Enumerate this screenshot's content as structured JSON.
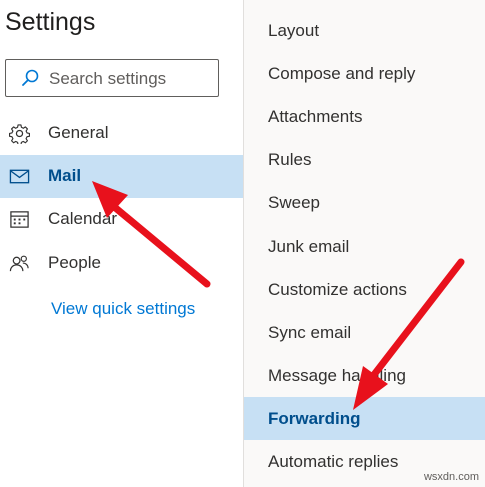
{
  "settings": {
    "title": "Settings",
    "search_placeholder": "Search settings"
  },
  "nav": {
    "items": [
      {
        "label": "General",
        "icon": "gear-icon"
      },
      {
        "label": "Mail",
        "icon": "mail-icon",
        "selected": true
      },
      {
        "label": "Calendar",
        "icon": "calendar-icon"
      },
      {
        "label": "People",
        "icon": "people-icon"
      }
    ],
    "quick_settings_link": "View quick settings"
  },
  "mail_settings": {
    "items": [
      {
        "label": "Layout"
      },
      {
        "label": "Compose and reply"
      },
      {
        "label": "Attachments"
      },
      {
        "label": "Rules"
      },
      {
        "label": "Sweep"
      },
      {
        "label": "Junk email"
      },
      {
        "label": "Customize actions"
      },
      {
        "label": "Sync email"
      },
      {
        "label": "Message handling"
      },
      {
        "label": "Forwarding",
        "selected": true
      },
      {
        "label": "Automatic replies"
      }
    ]
  },
  "colors": {
    "selected_bg": "#c7e0f4",
    "selected_text": "#004e8c",
    "link": "#0078d4",
    "annotation_arrow": "#e8111c"
  },
  "watermark": "wsxdn.com"
}
